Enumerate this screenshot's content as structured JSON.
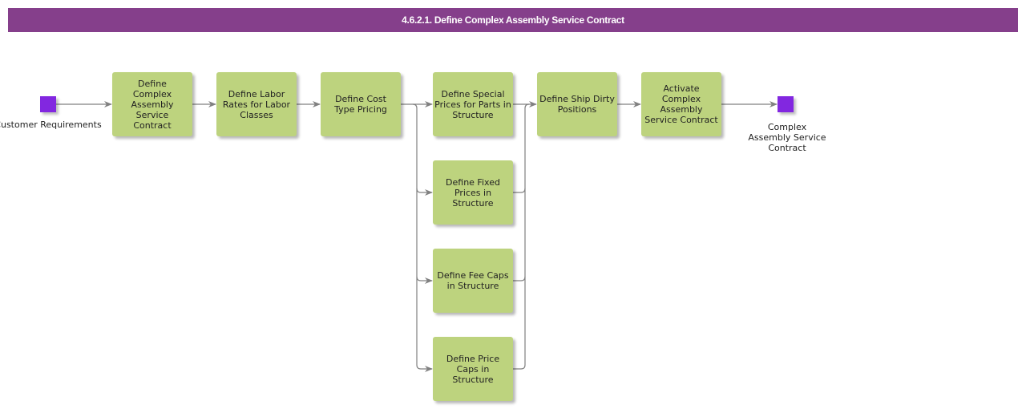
{
  "header": {
    "title": "4.6.2.1. Define Complex Assembly Service Contract"
  },
  "colors": {
    "header": "#853f8b",
    "task": "#bdd37e",
    "terminal": "#8227e0",
    "connector": "#808080"
  },
  "terminals": {
    "start": {
      "label": "Customer Requirements"
    },
    "end": {
      "label": "Complex Assembly Service Contract"
    }
  },
  "tasks": [
    {
      "id": "t1",
      "label": "Define Complex Assembly Service Contract"
    },
    {
      "id": "t2",
      "label": "Define Labor Rates for Labor Classes"
    },
    {
      "id": "t3",
      "label": "Define Cost Type Pricing"
    },
    {
      "id": "t4",
      "label": "Define Special Prices for Parts in Structure"
    },
    {
      "id": "t5",
      "label": "Define Fixed Prices in Structure"
    },
    {
      "id": "t6",
      "label": "Define Fee Caps in Structure"
    },
    {
      "id": "t7",
      "label": "Define Price Caps in Structure"
    },
    {
      "id": "t8",
      "label": "Define Ship Dirty Positions"
    },
    {
      "id": "t9",
      "label": "Activate Complex Assembly Service Contract"
    }
  ],
  "flows": [
    [
      "start",
      "t1"
    ],
    [
      "t1",
      "t2"
    ],
    [
      "t2",
      "t3"
    ],
    [
      "t3",
      "t4"
    ],
    [
      "t3",
      "t5"
    ],
    [
      "t3",
      "t6"
    ],
    [
      "t3",
      "t7"
    ],
    [
      "t4",
      "t8"
    ],
    [
      "t5",
      "t8"
    ],
    [
      "t6",
      "t8"
    ],
    [
      "t7",
      "t8"
    ],
    [
      "t8",
      "t9"
    ],
    [
      "t9",
      "end"
    ]
  ]
}
